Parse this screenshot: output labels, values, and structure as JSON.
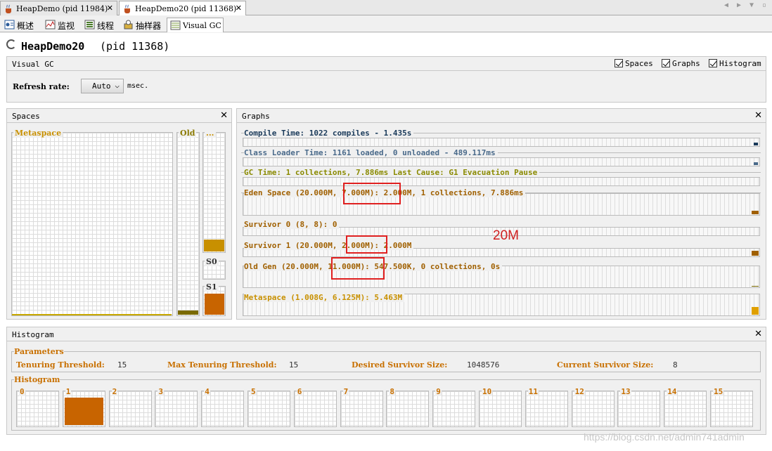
{
  "tabs": [
    {
      "label": "HeapDemo (pid 11984)"
    },
    {
      "label": "HeapDemo20 (pid 11368)"
    }
  ],
  "close_glyph": "✕",
  "subtabs": [
    {
      "label": "概述"
    },
    {
      "label": "监视"
    },
    {
      "label": "线程"
    },
    {
      "label": "抽样器"
    },
    {
      "label": "Visual GC"
    }
  ],
  "app": {
    "name": "HeapDemo20",
    "pid": "(pid 11368)"
  },
  "visual_gc": {
    "header": "Visual GC",
    "checkboxes": [
      "Spaces",
      "Graphs",
      "Histogram"
    ],
    "refresh_label": "Refresh rate:",
    "refresh_value": "Auto",
    "refresh_unit": "msec."
  },
  "spaces": {
    "header": "Spaces",
    "metaspace": "Metaspace",
    "old": "Old",
    "dots": "...",
    "s0": "S0",
    "s1": "S1",
    "fill": {
      "old": 0.025,
      "eden": 0.1,
      "s1": 1.0
    }
  },
  "graphs": {
    "header": "Graphs",
    "rows": [
      {
        "text": "Compile Time: 1022 compiles - 1.435s",
        "color": "#1a3a5a"
      },
      {
        "text": "Class Loader Time: 1161 loaded, 0 unloaded - 489.117ms",
        "color": "#4a6a8a"
      },
      {
        "text": "GC Time: 1 collections, 7.886ms Last Cause: G1 Evacuation Pause",
        "color": "#8a8a00"
      },
      {
        "text": "Eden Space (20.000M, 7.000M): 2.000M, 1 collections, 7.886ms",
        "color": "#a06000"
      },
      {
        "text": "Survivor 0 (8, 8): 0",
        "color": "#a06000"
      },
      {
        "text": "Survivor 1 (20.000M, 2.000M): 2.000M",
        "color": "#a06000"
      },
      {
        "text": "Old Gen (20.000M, 11.000M): 547.500K, 0 collections, 0s",
        "color": "#a06000"
      },
      {
        "text": "Metaspace (1.008G, 6.125M): 5.463M",
        "color": "#c89000"
      }
    ],
    "annotation": "20M"
  },
  "histogram": {
    "header": "Histogram",
    "params_title": "Parameters",
    "params": [
      {
        "label": "Tenuring Threshold:",
        "value": "15"
      },
      {
        "label": "Max Tenuring Threshold:",
        "value": "15"
      },
      {
        "label": "Desired Survivor Size:",
        "value": "1048576"
      },
      {
        "label": "Current Survivor Size:",
        "value": "8"
      }
    ],
    "hist_title": "Histogram",
    "buckets": [
      "0",
      "1",
      "2",
      "3",
      "4",
      "5",
      "6",
      "7",
      "8",
      "9",
      "10",
      "11",
      "12",
      "13",
      "14",
      "15"
    ],
    "filled_bucket": "1"
  },
  "watermark": "https://blog.csdn.net/admin741admin",
  "colors": {
    "fill": "#c86400",
    "old_fill": "#7a6a00",
    "red": "#e02020"
  }
}
